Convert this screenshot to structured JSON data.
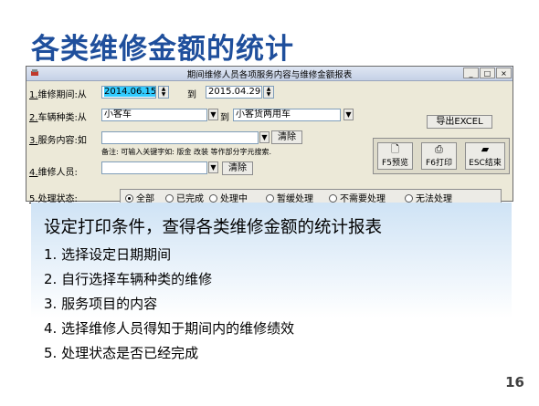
{
  "slide": {
    "title": "各类维修金额的统计",
    "page_number": "16"
  },
  "dialog": {
    "title": "期间维修人员各项服务内容与维修金额报表",
    "min_label": "_",
    "max_label": "□",
    "close_label": "×",
    "period": {
      "label_num": "1.",
      "label": "维修期间:从",
      "from": "2014.06.15",
      "to_label": "到",
      "to": "2015.04.29"
    },
    "vehicle": {
      "label_num": "2.",
      "label": "车辆种类:从",
      "from": "小客车",
      "to_label": "到",
      "to": "小客货两用车"
    },
    "service": {
      "label_num": "3.",
      "label": "服务内容:如",
      "value": "",
      "clear_label": "清除",
      "note": "备注: 可输入关键字如: 版金 改装 等作部分字元搜索."
    },
    "staff": {
      "label_num": "4.",
      "label": "维修人员:",
      "value": "",
      "clear_label": "清除"
    },
    "status": {
      "label_num": "5.",
      "label": "处理状态:",
      "options": [
        "全部",
        "已完成",
        "处理中",
        "暂缓处理",
        "不需要处理",
        "无法处理"
      ],
      "selected": "全部"
    },
    "export_label": "导出EXCEL",
    "toolbar": {
      "preview_label": "F5预览",
      "print_label": "F6打印",
      "exit_label": "ESC结束"
    }
  },
  "content": {
    "heading": "设定打印条件，查得各类维修金额的统计报表",
    "items": [
      "1. 选择设定日期期间",
      "2. 自行选择车辆种类的维修",
      "3. 服务项目的内容",
      "4. 选择维修人员得知于期间内的维修绩效",
      "5. 处理状态是否已经完成"
    ]
  }
}
